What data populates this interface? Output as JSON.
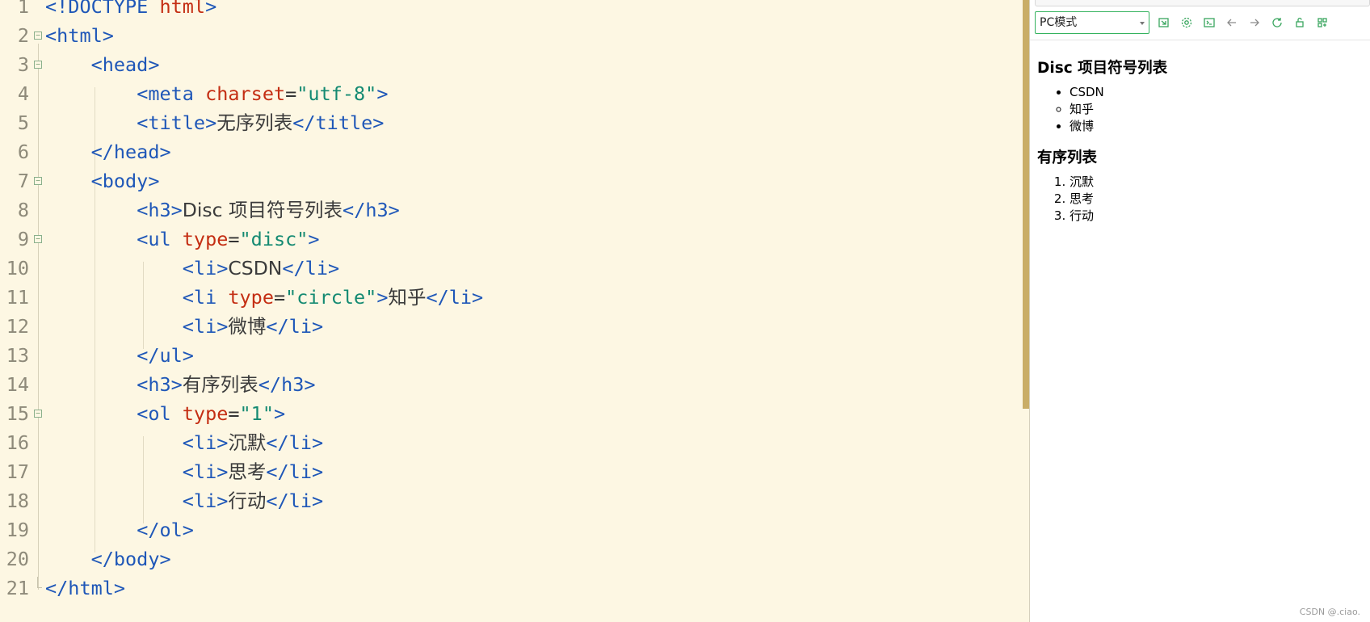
{
  "editor": {
    "lines": [
      {
        "n": "1",
        "html": "<span class='tag'>&lt;!DOCTYPE </span><span class='attr'>html</span><span class='tag'>&gt;</span>"
      },
      {
        "n": "2",
        "html": "<span class='tag'>&lt;html&gt;</span>"
      },
      {
        "n": "3",
        "html": "    <span class='tag'>&lt;head&gt;</span>"
      },
      {
        "n": "4",
        "html": "        <span class='tag'>&lt;meta </span><span class='attr'>charset</span>=<span class='str'>\"utf-8\"</span><span class='tag'>&gt;</span>"
      },
      {
        "n": "5",
        "html": "        <span class='tag'>&lt;title&gt;</span><span class='txt'>无序列表</span><span class='tag'>&lt;/title&gt;</span>"
      },
      {
        "n": "6",
        "html": "    <span class='tag'>&lt;/head&gt;</span>"
      },
      {
        "n": "7",
        "html": "    <span class='tag'>&lt;body&gt;</span>"
      },
      {
        "n": "8",
        "html": "        <span class='tag'>&lt;h3&gt;</span><span class='txt'>Disc 项目符号列表</span><span class='tag'>&lt;/h3&gt;</span>"
      },
      {
        "n": "9",
        "html": "        <span class='tag'>&lt;ul </span><span class='attr'>type</span>=<span class='str'>\"disc\"</span><span class='tag'>&gt;</span>"
      },
      {
        "n": "10",
        "html": "            <span class='tag'>&lt;li&gt;</span><span class='txt'>CSDN</span><span class='tag'>&lt;/li&gt;</span>"
      },
      {
        "n": "11",
        "html": "            <span class='tag'>&lt;li </span><span class='attr'>type</span>=<span class='str'>\"circle\"</span><span class='tag'>&gt;</span><span class='txt'>知乎</span><span class='tag'>&lt;/li&gt;</span>"
      },
      {
        "n": "12",
        "html": "            <span class='tag'>&lt;li&gt;</span><span class='txt'>微博</span><span class='tag'>&lt;/li&gt;</span>"
      },
      {
        "n": "13",
        "html": "        <span class='tag'>&lt;/ul&gt;</span>"
      },
      {
        "n": "14",
        "html": "        <span class='tag'>&lt;h3&gt;</span><span class='txt'>有序列表</span><span class='tag'>&lt;/h3&gt;</span>"
      },
      {
        "n": "15",
        "html": "        <span class='tag'>&lt;ol </span><span class='attr'>type</span>=<span class='str'>\"1\"</span><span class='tag'>&gt;</span>"
      },
      {
        "n": "16",
        "html": "            <span class='tag'>&lt;li&gt;</span><span class='txt'>沉默</span><span class='tag'>&lt;/li&gt;</span>"
      },
      {
        "n": "17",
        "html": "            <span class='tag'>&lt;li&gt;</span><span class='txt'>思考</span><span class='tag'>&lt;/li&gt;</span>"
      },
      {
        "n": "18",
        "html": "            <span class='tag'>&lt;li&gt;</span><span class='txt'>行动</span><span class='tag'>&lt;/li&gt;</span>"
      },
      {
        "n": "19",
        "html": "        <span class='tag'>&lt;/ol&gt;</span>"
      },
      {
        "n": "20",
        "html": "    <span class='tag'>&lt;/body&gt;</span>"
      },
      {
        "n": "21",
        "html": "<span class='tag'>&lt;/html&gt;</span>"
      }
    ],
    "fold_open_lines": [
      "2",
      "3",
      "7",
      "9",
      "15"
    ],
    "fold_end_lines": [
      "21"
    ]
  },
  "preview": {
    "mode": "PC模式",
    "toolbar_icons": [
      "open-external-icon",
      "settings-icon",
      "console-icon",
      "back-arrow-icon",
      "forward-arrow-icon",
      "refresh-icon",
      "unlock-icon",
      "grid-icon"
    ],
    "page": {
      "heading1": "Disc 项目符号列表",
      "ul_items": [
        "CSDN",
        "知乎",
        "微博"
      ],
      "heading2": "有序列表",
      "ol_items": [
        "沉默",
        "思考",
        "行动"
      ]
    }
  },
  "watermark": "CSDN @.ciao."
}
